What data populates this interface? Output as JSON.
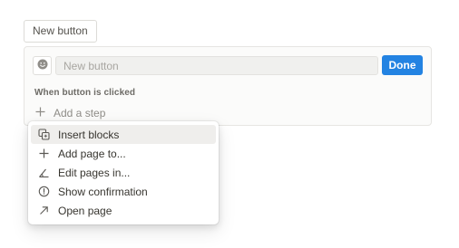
{
  "header": {
    "new_button_label": "New button"
  },
  "editor": {
    "emoji_icon": "smiley-icon",
    "name_placeholder": "New button",
    "name_value": "",
    "done_label": "Done",
    "trigger_label": "When button is clicked",
    "add_step_label": "Add a step"
  },
  "menu": {
    "items": [
      {
        "label": "Insert blocks",
        "icon": "insert-blocks-icon",
        "active": true
      },
      {
        "label": "Add page to...",
        "icon": "plus-icon",
        "active": false
      },
      {
        "label": "Edit pages in...",
        "icon": "edit-pages-icon",
        "active": false
      },
      {
        "label": "Show confirmation",
        "icon": "confirmation-icon",
        "active": false
      },
      {
        "label": "Open page",
        "icon": "arrow-up-right-icon",
        "active": false
      }
    ]
  },
  "colors": {
    "accent": "#2383e2",
    "menu_hover": "#efeeec",
    "panel_bg": "#fbfbfa"
  }
}
